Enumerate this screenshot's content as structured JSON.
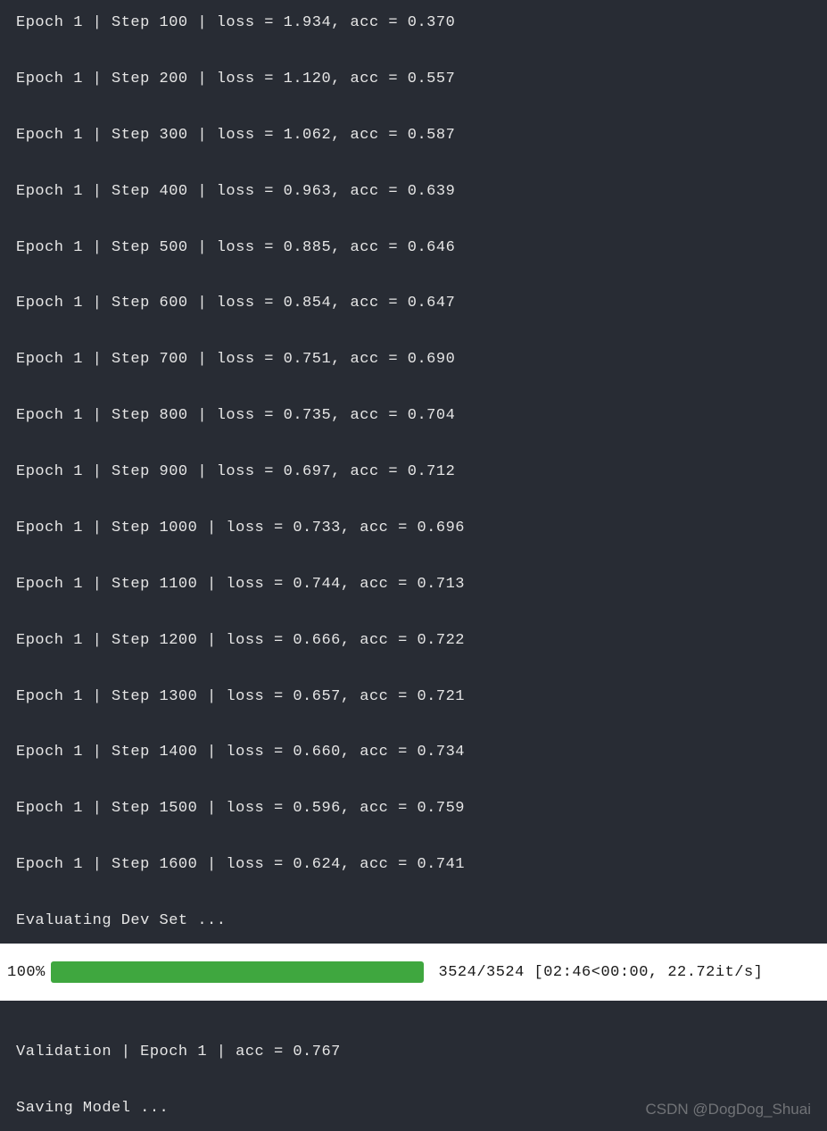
{
  "training_log": {
    "epoch_label": "Epoch",
    "step_label": "Step",
    "loss_label": "loss",
    "acc_label": "acc",
    "epoch": 1,
    "steps": [
      {
        "step": 100,
        "loss": "1.934",
        "acc": "0.370"
      },
      {
        "step": 200,
        "loss": "1.120",
        "acc": "0.557"
      },
      {
        "step": 300,
        "loss": "1.062",
        "acc": "0.587"
      },
      {
        "step": 400,
        "loss": "0.963",
        "acc": "0.639"
      },
      {
        "step": 500,
        "loss": "0.885",
        "acc": "0.646"
      },
      {
        "step": 600,
        "loss": "0.854",
        "acc": "0.647"
      },
      {
        "step": 700,
        "loss": "0.751",
        "acc": "0.690"
      },
      {
        "step": 800,
        "loss": "0.735",
        "acc": "0.704"
      },
      {
        "step": 900,
        "loss": "0.697",
        "acc": "0.712"
      },
      {
        "step": 1000,
        "loss": "0.733",
        "acc": "0.696"
      },
      {
        "step": 1100,
        "loss": "0.744",
        "acc": "0.713"
      },
      {
        "step": 1200,
        "loss": "0.666",
        "acc": "0.722"
      },
      {
        "step": 1300,
        "loss": "0.657",
        "acc": "0.721"
      },
      {
        "step": 1400,
        "loss": "0.660",
        "acc": "0.734"
      },
      {
        "step": 1500,
        "loss": "0.596",
        "acc": "0.759"
      },
      {
        "step": 1600,
        "loss": "0.624",
        "acc": "0.741"
      }
    ],
    "eval_message": "Evaluating Dev Set ..."
  },
  "progress": {
    "percent_label": "100%",
    "percent_value": 100,
    "current": 3524,
    "total": 3524,
    "elapsed": "02:46",
    "remaining": "00:00",
    "rate": "22.72it/s",
    "stats_text": " 3524/3524 [02:46<00:00, 22.72it/s]"
  },
  "validation": {
    "line": "Validation | Epoch 1 | acc = 0.767",
    "saving_message": "Saving Model ...",
    "epoch": 1,
    "acc": "0.767"
  },
  "watermark": "CSDN @DogDog_Shuai"
}
